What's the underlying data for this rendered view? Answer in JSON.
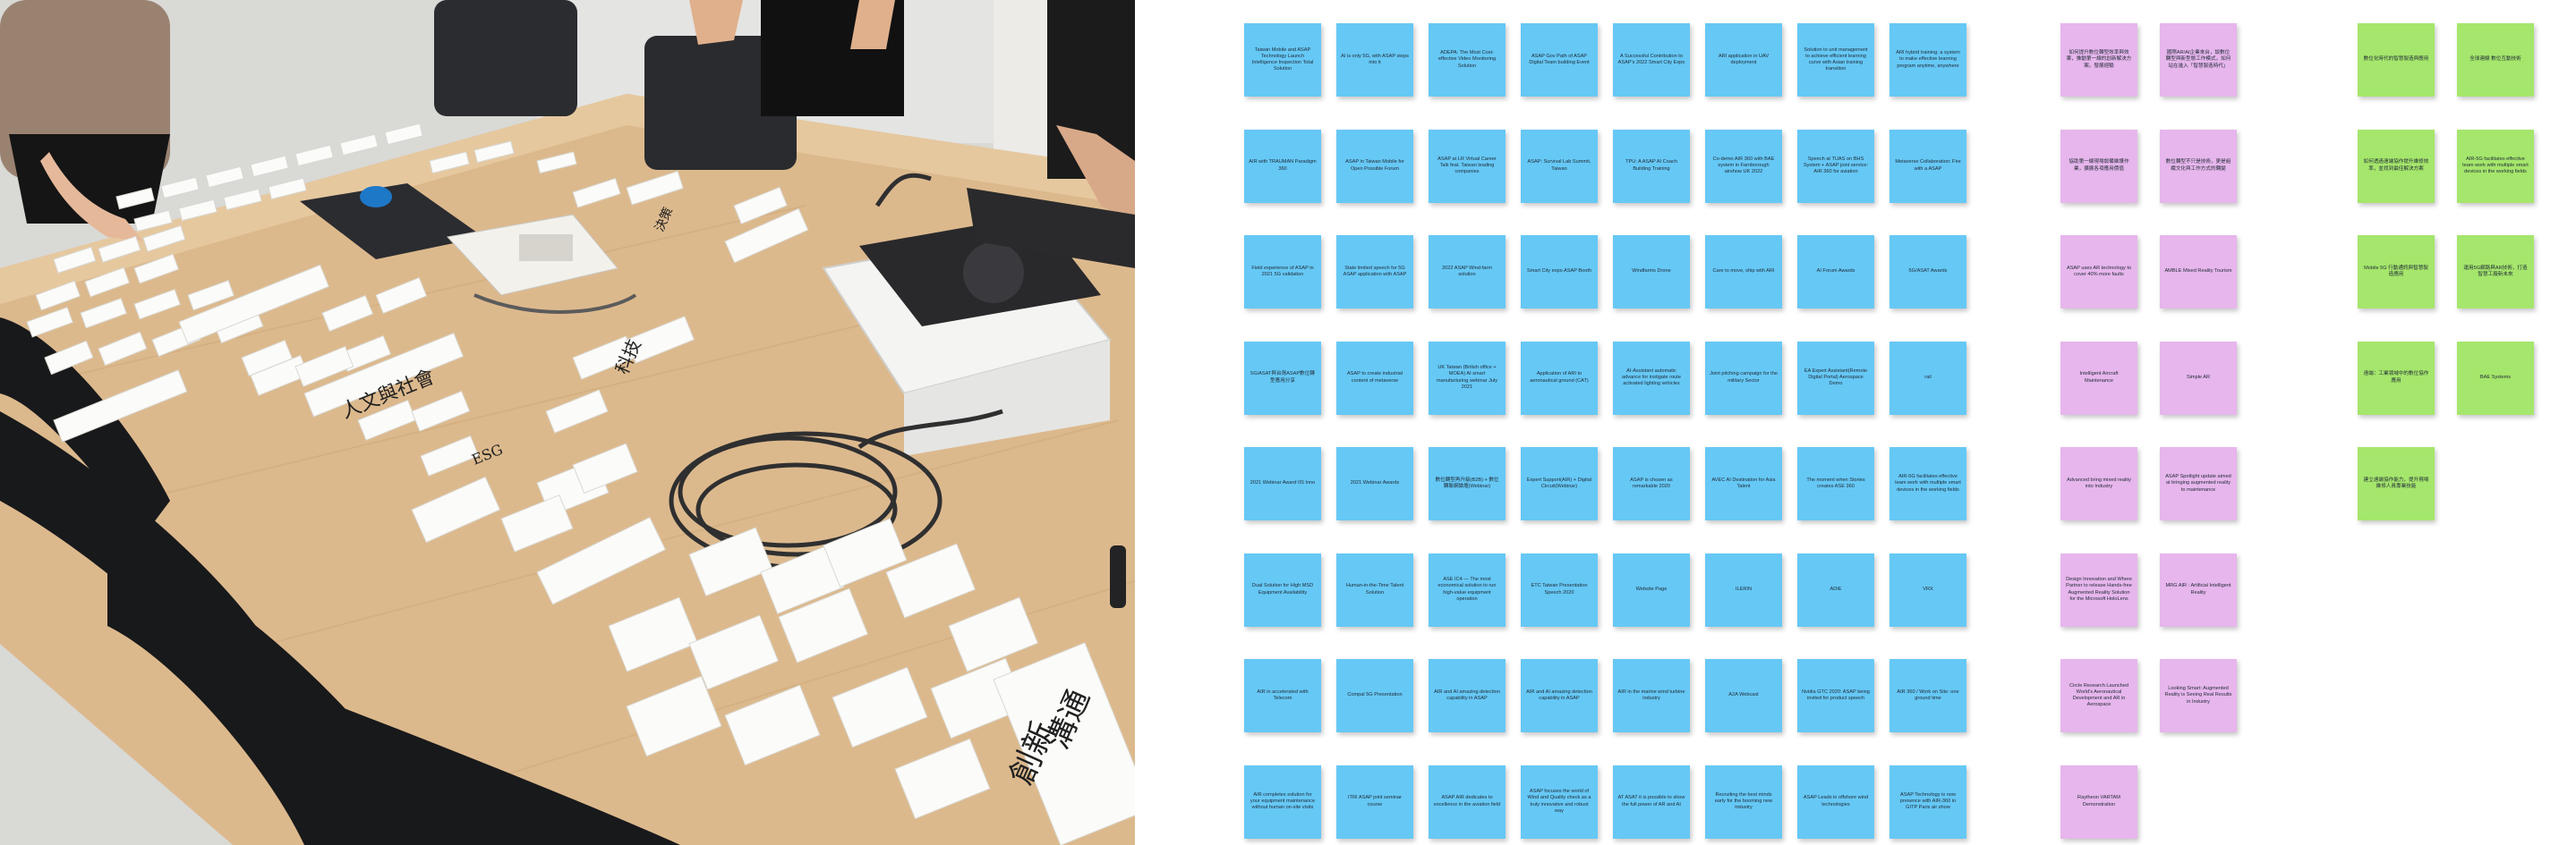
{
  "photo": {
    "handwritten_cards": [
      "人文與社會",
      "科技",
      "ESG",
      "創新",
      "溝通",
      "決策"
    ]
  },
  "board": {
    "colors": {
      "blue": "#66c8f5",
      "pink": "#e6b6ec",
      "green": "#a5e66c"
    },
    "blue_notes": [
      "Taiwan Mobile and ASAP Technology Launch Intelligence Inspection Total Solution",
      "AI is only 5G, with ASAP steps into it",
      "ADEPA: The Most Cost-effective Video Monitoring Solution",
      "ASAP Gov Path of ASAP Digital Team building Event",
      "A Successful Contribution to ASAP's 2022 Smart City Expo",
      "ARI application in UAV deployment",
      "Solution to unit management to achieve efficient learning curve with Asian training transition",
      "ARI hybrid training: a system to make effective learning program anytime, anywhere",
      "AIR with TRAUMAN Paradigm 360",
      "ASAP in Taiwan Mobile for Open Possible Forum",
      "ASAP at LR Virtual Career Talk feat. Taiwan leading companies",
      "ASAP: Survival Lab Summit, Taiwan",
      "TPU: A ASAP AI Coach Building Training",
      "Co-demo AIR 360 with BAE system in Farnborough airshow UK 2022",
      "Speech at TUAS on BHS System + ASAP joint service: AIR 360 for aviation",
      "Metaverse Collaboration: Fire with a ASAP",
      "Field experience of ASAP in 2021 5G validation",
      "State limited speech for 5G ASAP application with ASAP",
      "2022 ASAP Wind-farm solution",
      "Smart City expo ASAP Booth",
      "Windfarms Drone",
      "Care to move, ship with ARI",
      "AI Forum Awards",
      "5G/ASAT Awards",
      "5G/ASAT與台灣ASAP數位轉型應用分享",
      "ASAP to create industrial content of metaverse",
      "UK Taiwan (British office + MOEA) AI smart manufacturing webinar July 2021",
      "Application of ARI to aeronautical ground (CAT)",
      "AI-Assistant automatic advance for instigate route activated lighting vehicles",
      "Joint pitching campaign for the military Sector",
      "EA Expert Assistant(Remote Digital Portal) Aerospace Demo",
      "rail",
      "2021 Webinar Award IIS Inno",
      "2021 Webinar Awards",
      "數位轉型再升級(B2B) + 數位轉聯網論壇(Webinar)",
      "Expert Support(AIR) + Digital Circuit(Webinar)",
      "ASAP is chosen as remarkable 2020",
      "AVEC AI Destination for Asia Talent",
      "The moment when Stories creates ASE 360",
      "AIR-5G facilitates effective team work with multiple smart devices in the working fields",
      "Dual Solution for High MSD Equipment Availability",
      "Human-in-the-Time Talent Solution",
      "ASE IC4 — The most economical solution to run high-value equipment operation",
      "ETC Taiwan Presentation Speech 2020",
      "Website Page",
      "ILERIN",
      "ADIE",
      "VRX",
      "AIR in accelerated with Telecom",
      "Compal 5G Presentation",
      "AIR and AI amazing detection capability in ASAP",
      "AIR and AI amazing detection capability in ASAP",
      "AIR in the marine wind turbine industry",
      "A2A Webcast",
      "Nvidia GTC 2020: ASAP being invited for product speech",
      "AIR 360 / Work on Site: one ground time",
      "AIR completes solution for your equipment maintenance without human on-site visits",
      "ITRI ASAP joint seminar course",
      "ASAP AIR dedicates to excellence in the aviation field",
      "ASAP focuses the world of Wind and Quality check as a truly innovative and robust way",
      "AT ASAT it is possible to show the full power of AR and AI",
      "Recruiting the best minds early for the booming new industry",
      "ASAP Leads in offshore wind technologies",
      "ASAP Technology is now presence with AIR-360 in GITP Paris air show"
    ],
    "pink_notes": [
      "如何提升數位轉型效率與效果，推動第一線的創新解決方案。發展經驗",
      "國際AR/AI企業來台，談數位轉型與新型態工作模式，如何站在進入「智慧製造時代」",
      "協助第一線現場設備維護作業，擴展各項應用價值",
      "數位轉型不只是技術，更是組織文化與工作方式的轉變",
      "ASAP uses AR technology to cover 40% more faults",
      "AMBLE Mixed Reality Tourism",
      "Intelligent Aircraft Maintenance",
      "Simple AR",
      "Advanced bring mixed reality into Industry",
      "ASAP Spotlight update aimed at bringing augmented reality to maintenance",
      "Design Innovation and Where Partner to release Hands-free Augmented Reality Solution for the Microsoft HoloLens",
      "MRG AIR : Artificial Intelligent Reality",
      "Circle Research Launched World's Aeronautical Development and AR in Aerospace",
      "Looking Smart: Augmented Reality is Seeing Real Results in Industry",
      "Raytheon VARTAM Demonstration"
    ],
    "green_notes": [
      "數位化時代的智慧製造與應用",
      "全球連線 數位互動技術",
      "如何透過遠端協作提升維修效率，並找到最佳解決方案",
      "AIR-5G facilitates effective team work with multiple smart devices in the working fields",
      "Mobile 5G 行動通訊與智慧製造應用",
      "運用5G網路與AR技術，打造智慧工廠新未來",
      "遠端：工業領域中的數位協作應用",
      "BAE Systems",
      "建立遠端協作能力，提升現場維修人員專業技能"
    ]
  }
}
